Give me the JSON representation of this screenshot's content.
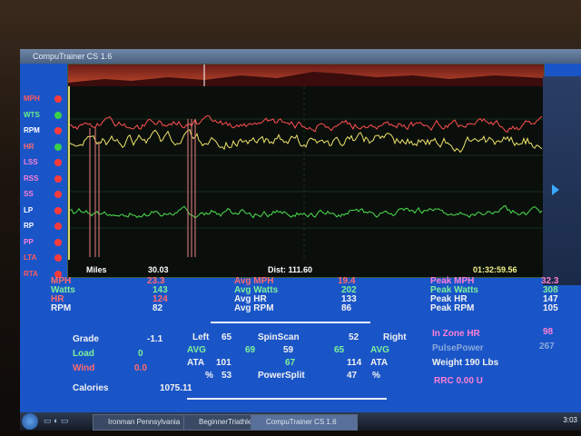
{
  "window": {
    "title": "CompuTrainer CS 1.6"
  },
  "sidebar": {
    "items": [
      {
        "label": "MPH",
        "color": "#ff5a5a",
        "dot": "#ff3a3a"
      },
      {
        "label": "WTS",
        "color": "#6cf08a",
        "dot": "#3ad04a"
      },
      {
        "label": "RPM",
        "color": "#ffffff",
        "dot": "#ff3a3a"
      },
      {
        "label": "HR",
        "color": "#ff6a6a",
        "dot": "#3ad04a"
      },
      {
        "label": "LSS",
        "color": "#ff7fd4",
        "dot": "#ff3a3a"
      },
      {
        "label": "RSS",
        "color": "#ff7fd4",
        "dot": "#ff3a3a"
      },
      {
        "label": "SS",
        "color": "#ff7fd4",
        "dot": "#ff3a3a"
      },
      {
        "label": "LP",
        "color": "#ffffff",
        "dot": "#ff3a3a"
      },
      {
        "label": "RP",
        "color": "#ffffff",
        "dot": "#ff3a3a"
      },
      {
        "label": "PP",
        "color": "#ff7fd4",
        "dot": "#ff3a3a"
      },
      {
        "label": "LTA",
        "color": "#ff5a5a",
        "dot": "#ff3a3a"
      },
      {
        "label": "RTA",
        "color": "#ff5a5a",
        "dot": "#ff3a3a"
      }
    ]
  },
  "plot_footer": {
    "miles_label": "Miles",
    "miles_value": "30.03",
    "dist_label": "Dist: 111.60",
    "time": "01:32:59.56"
  },
  "stats": {
    "mph": {
      "label": "MPH",
      "value": "23.3"
    },
    "watts": {
      "label": "Watts",
      "value": "143"
    },
    "hr": {
      "label": "HR",
      "value": "124"
    },
    "rpm": {
      "label": "RPM",
      "value": "82"
    },
    "avg_mph": {
      "label": "Avg MPH",
      "value": "19.4"
    },
    "avg_watts": {
      "label": "Avg Watts",
      "value": "202"
    },
    "avg_hr": {
      "label": "Avg HR",
      "value": "133"
    },
    "avg_rpm": {
      "label": "Avg RPM",
      "value": "86"
    },
    "peak_mph": {
      "label": "Peak MPH",
      "value": "32.3"
    },
    "peak_watts": {
      "label": "Peak Watts",
      "value": "308"
    },
    "peak_hr": {
      "label": "Peak HR",
      "value": "147"
    },
    "peak_rpm": {
      "label": "Peak RPM",
      "value": "105"
    }
  },
  "lower": {
    "grade": {
      "label": "Grade",
      "value": "-1.1"
    },
    "load": {
      "label": "Load",
      "value": "0"
    },
    "wind": {
      "label": "Wind",
      "value": "0.0"
    },
    "calories": {
      "label": "Calories",
      "value": "1075.11"
    },
    "spinscan_title": "SpinScan",
    "left_label": "Left",
    "left_value": "65",
    "right_label": "Right",
    "right_value": "52",
    "avg_label_left": "AVG",
    "avg_left": "69",
    "ss_center": "59",
    "avg_right": "65",
    "avg_label_right": "AVG",
    "ata_label_left": "ATA",
    "ata_left": "101",
    "ata_center": "67",
    "ata_right": "114",
    "ata_label_right": "ATA",
    "pct_left_label": "%",
    "pct_left": "53",
    "powersplit": "PowerSplit",
    "pct_right": "47",
    "pct_right_label": "%",
    "inzone_label": "In Zone HR",
    "inzone_value": "98",
    "pulsepower_label": "PulsePower",
    "pulsepower_value": "267",
    "weight": "Weight 190 Lbs",
    "rrc": "RRC 0.00 U"
  },
  "taskbar": {
    "items": [
      "Ironman Pennsylvania",
      "BeginnerTriathlete.c...",
      "CompuTrainer CS 1.6"
    ],
    "clock": "3:03"
  },
  "chart_data": {
    "type": "line",
    "series": [
      {
        "name": "MPH",
        "color": "#ff4a4a"
      },
      {
        "name": "HR",
        "color": "#ff5a5a"
      },
      {
        "name": "Watts",
        "color": "#f0e46a"
      },
      {
        "name": "RPM",
        "color": "#4ee04e"
      }
    ]
  }
}
